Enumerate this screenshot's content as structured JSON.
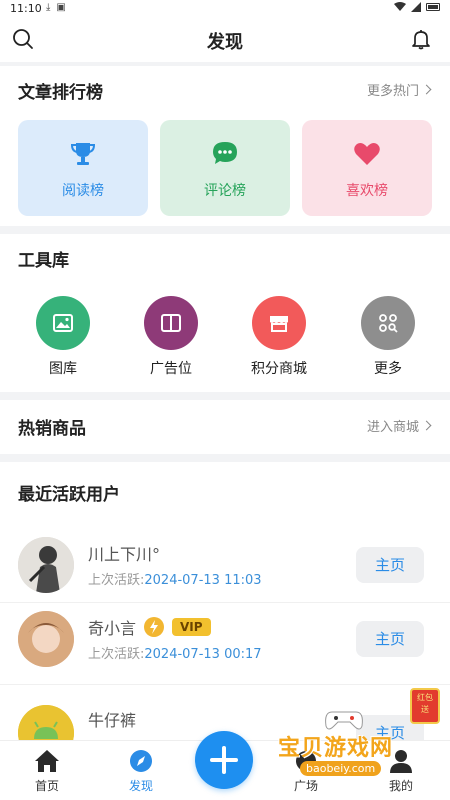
{
  "statusbar": {
    "time": "11:10"
  },
  "header": {
    "title": "发现"
  },
  "ranking": {
    "title": "文章排行榜",
    "more": "更多热门",
    "items": [
      {
        "label": "阅读榜",
        "icon": "trophy-icon",
        "color": "#2b8ce6",
        "bg": "#dcebfb"
      },
      {
        "label": "评论榜",
        "icon": "chat-bubble-icon",
        "color": "#26a35a",
        "bg": "#dbf0e3"
      },
      {
        "label": "喜欢榜",
        "icon": "heart-icon",
        "color": "#e84a6b",
        "bg": "#fbe1e7"
      }
    ]
  },
  "tools": {
    "title": "工具库",
    "items": [
      {
        "label": "图库",
        "icon": "image-icon",
        "color": "#36b27a"
      },
      {
        "label": "广告位",
        "icon": "book-icon",
        "color": "#8e3a78"
      },
      {
        "label": "积分商城",
        "icon": "shop-icon",
        "color": "#f25a5a"
      },
      {
        "label": "更多",
        "icon": "grid-search-icon",
        "color": "#8e8e8e"
      }
    ]
  },
  "hot": {
    "title": "热销商品",
    "more": "进入商城"
  },
  "active_users": {
    "title": "最近活跃用户",
    "last_prefix": "上次活跃:",
    "button": "主页",
    "users": [
      {
        "name": "川上下川°",
        "last": "2024-07-13 11:03"
      },
      {
        "name": "奇小言",
        "badge": "VIP",
        "last": "2024-07-13 00:17"
      },
      {
        "name": "牛仔裤",
        "last": ""
      }
    ]
  },
  "tabbar": {
    "items": [
      {
        "label": "首页"
      },
      {
        "label": "发现"
      },
      {
        "label": "广场"
      },
      {
        "label": "我的"
      }
    ]
  },
  "watermark": {
    "text": "宝贝游戏网",
    "url": "baobeiy.com",
    "redbag": "红包 天天送"
  }
}
